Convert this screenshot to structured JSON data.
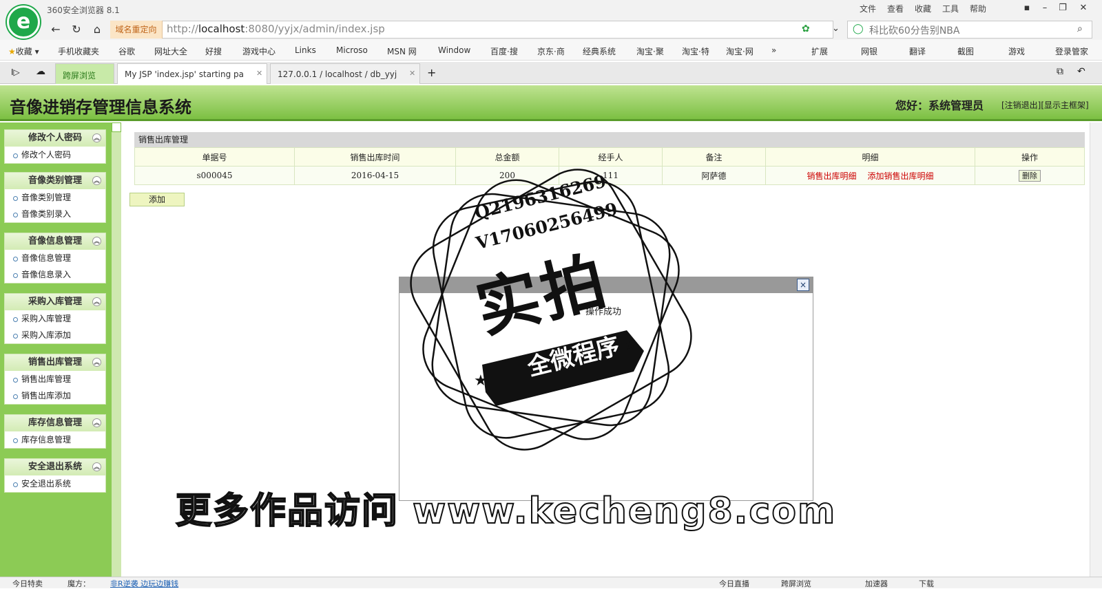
{
  "browser": {
    "app_title": "360安全浏览器 8.1",
    "menu": [
      "文件",
      "查看",
      "收藏",
      "工具",
      "帮助"
    ],
    "redirect_label": "域名重定向",
    "url_host": "localhost",
    "url_prefix": "http://",
    "url_rest": ":8080/yyjx/admin/index.jsp",
    "search_text": "科比砍60分告别NBA",
    "bookmarks": [
      "收藏",
      "手机收藏夹",
      "谷歌",
      "网址大全",
      "好搜",
      "游戏中心",
      "Links",
      "Microso",
      "MSN 网",
      "Window",
      "百度·搜",
      "京东·商",
      "经典系统",
      "淘宝·聚",
      "淘宝·特",
      "淘宝·网"
    ],
    "bookmark_right": [
      "扩展",
      "网银",
      "翻译",
      "截图",
      "游戏",
      "登录管家"
    ],
    "tabs": [
      {
        "label": "跨屏浏览"
      },
      {
        "label": "My JSP 'index.jsp' starting pa"
      },
      {
        "label": "127.0.0.1 / localhost / db_yyj"
      }
    ]
  },
  "app": {
    "name": "音像进销存管理信息系统",
    "welcome": "您好：系统管理员",
    "logout": "[注销退出]",
    "show_frame": "[显示主框架]"
  },
  "sidebar": {
    "groups": [
      {
        "title": "修改个人密码",
        "items": [
          "修改个人密码"
        ]
      },
      {
        "title": "音像类别管理",
        "items": [
          "音像类别管理",
          "音像类别录入"
        ]
      },
      {
        "title": "音像信息管理",
        "items": [
          "音像信息管理",
          "音像信息录入"
        ]
      },
      {
        "title": "采购入库管理",
        "items": [
          "采购入库管理",
          "采购入库添加"
        ]
      },
      {
        "title": "销售出库管理",
        "items": [
          "销售出库管理",
          "销售出库添加"
        ]
      },
      {
        "title": "库存信息管理",
        "items": [
          "库存信息管理"
        ]
      },
      {
        "title": "安全退出系统",
        "items": [
          "安全退出系统"
        ]
      }
    ]
  },
  "main": {
    "panel_title": "销售出库管理",
    "columns": [
      "单据号",
      "销售出库时间",
      "总金额",
      "经手人",
      "备注",
      "明细",
      "操作"
    ],
    "rows": [
      {
        "id": "s000045",
        "date": "2016-04-15",
        "amount": "200",
        "handler": "111",
        "note": "阿萨德",
        "detail_link": "销售出库明细",
        "add_detail_link": "添加销售出库明细",
        "delete": "删除"
      }
    ],
    "add_button": "添加"
  },
  "modal": {
    "message": "操作成功",
    "close": "×"
  },
  "watermark": {
    "qq": "Q2196316269",
    "v": "V17060256499",
    "big": "实拍",
    "small": "全微程序",
    "footer": "更多作品访问 www.kecheng8.com"
  },
  "status": {
    "left": [
      "今日特卖",
      "魔方：",
      "非R逆袭 边玩边赚钱"
    ],
    "right": [
      "今日直播",
      "跨屏浏览",
      "加速器",
      "下载"
    ]
  }
}
